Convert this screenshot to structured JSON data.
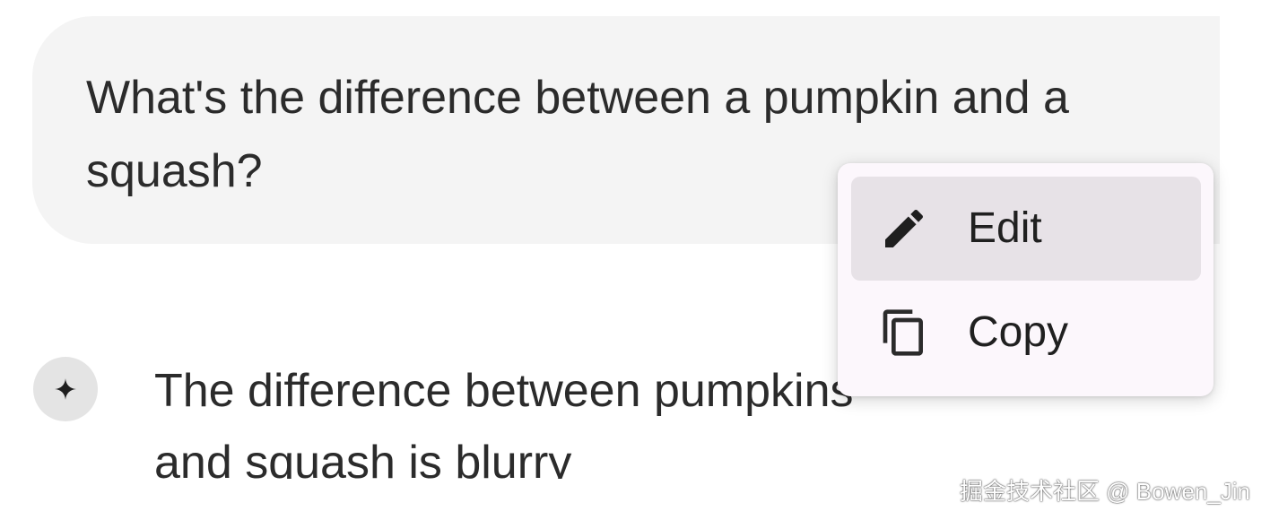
{
  "conversation": {
    "user_message": "What's the difference between a pumpkin and a squash?",
    "assistant_message": "The difference between pumpkins and squash is blurry",
    "assistant_avatar_icon": "sparkle-icon"
  },
  "context_menu": {
    "items": [
      {
        "label": "Edit",
        "icon": "pencil-icon"
      },
      {
        "label": "Copy",
        "icon": "copy-icon"
      }
    ]
  },
  "watermark": "掘金技术社区 @ Bowen_Jin",
  "colors": {
    "user_bubble": "#f4f4f4",
    "menu_background": "#fcf7fc",
    "menu_hover": "#e7e2e7",
    "avatar_background": "#e4e4e4",
    "text": "#2b2b2b"
  }
}
